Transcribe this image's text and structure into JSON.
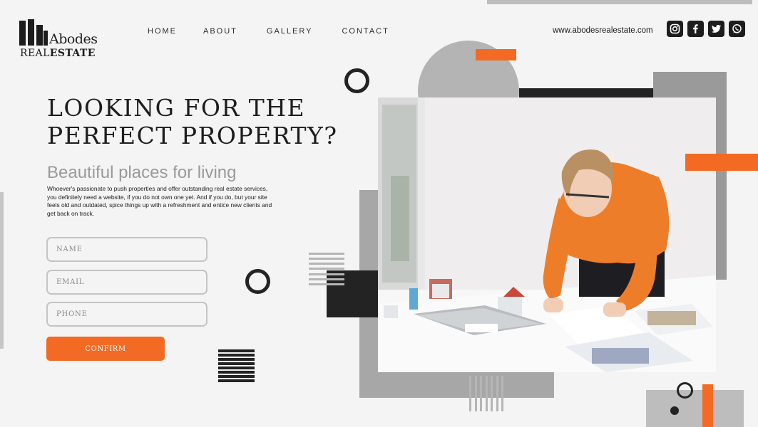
{
  "logo": {
    "name": "Abodes",
    "sub_regular": "REAL",
    "sub_bold": "ESTATE"
  },
  "nav": {
    "items": [
      "HOME",
      "ABOUT",
      "GALLERY",
      "CONTACT"
    ]
  },
  "header": {
    "website": "www.abodesrealestate.com",
    "social_icons": [
      "instagram-icon",
      "facebook-icon",
      "twitter-icon",
      "whatsapp-icon"
    ]
  },
  "hero": {
    "title_line1": "LOOKING FOR THE",
    "title_line2": "PERFECT PROPERTY?",
    "subtitle": "Beautiful places for living",
    "description": "Whoever's passionate to push properties and offer outstanding real estate services, you definitely need a website, if you do not own one yet. And if you do, but your site feels old and outdated, spice things up with a refreshment and entice new clients and get back on track."
  },
  "form": {
    "name_placeholder": "NAME",
    "email_placeholder": "EMAIL",
    "phone_placeholder": "PHONE",
    "confirm_label": "CONFIRM"
  },
  "colors": {
    "accent": "#f26a24",
    "dark": "#232323",
    "gray": "#a7a7a7",
    "background": "#f4f4f4"
  }
}
